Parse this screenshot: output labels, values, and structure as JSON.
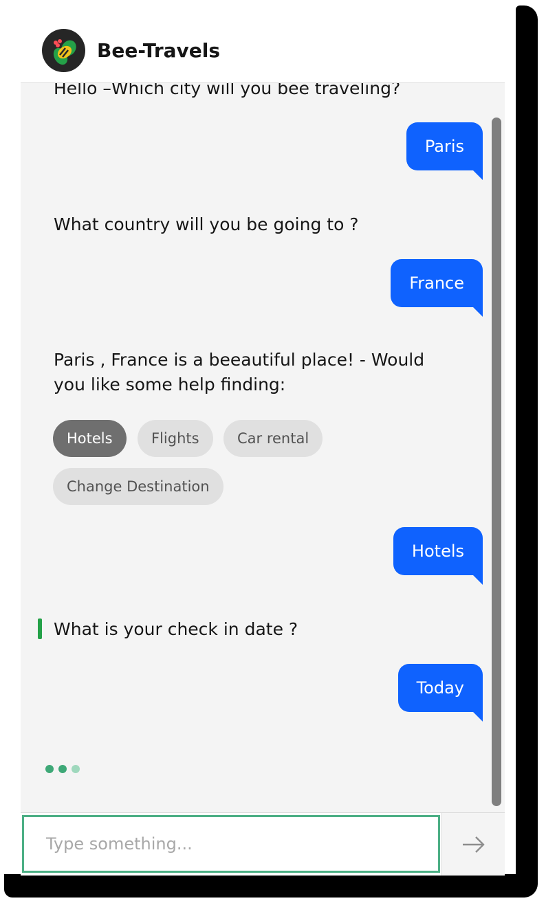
{
  "header": {
    "title": "Bee-Travels",
    "logo_icon": "bee-logo-icon"
  },
  "conversation": [
    {
      "from": "bot",
      "text": "Hello –Which city will you bee traveling?"
    },
    {
      "from": "user",
      "text": "Paris"
    },
    {
      "from": "bot",
      "text": "What country will you be going to ?"
    },
    {
      "from": "user",
      "text": "France"
    },
    {
      "from": "bot",
      "text": "Paris , France is a beeautiful place! - Would you like some help finding:"
    },
    {
      "from": "user",
      "text": "Hotels"
    },
    {
      "from": "bot",
      "text": "What is your check in date ?"
    },
    {
      "from": "user",
      "text": "Today"
    }
  ],
  "options": [
    {
      "label": "Hotels",
      "selected": true
    },
    {
      "label": "Flights",
      "selected": false
    },
    {
      "label": "Car rental",
      "selected": false
    },
    {
      "label": "Change Destination",
      "selected": false
    }
  ],
  "typing_indicator": {
    "dots": 3
  },
  "input": {
    "placeholder": "Type something...",
    "value": ""
  },
  "send": {
    "icon": "arrow-right-icon"
  },
  "colors": {
    "user_bubble": "#0f62fe",
    "focus_accent": "#24a148",
    "input_border": "#4caf85",
    "background": "#f4f4f4"
  }
}
